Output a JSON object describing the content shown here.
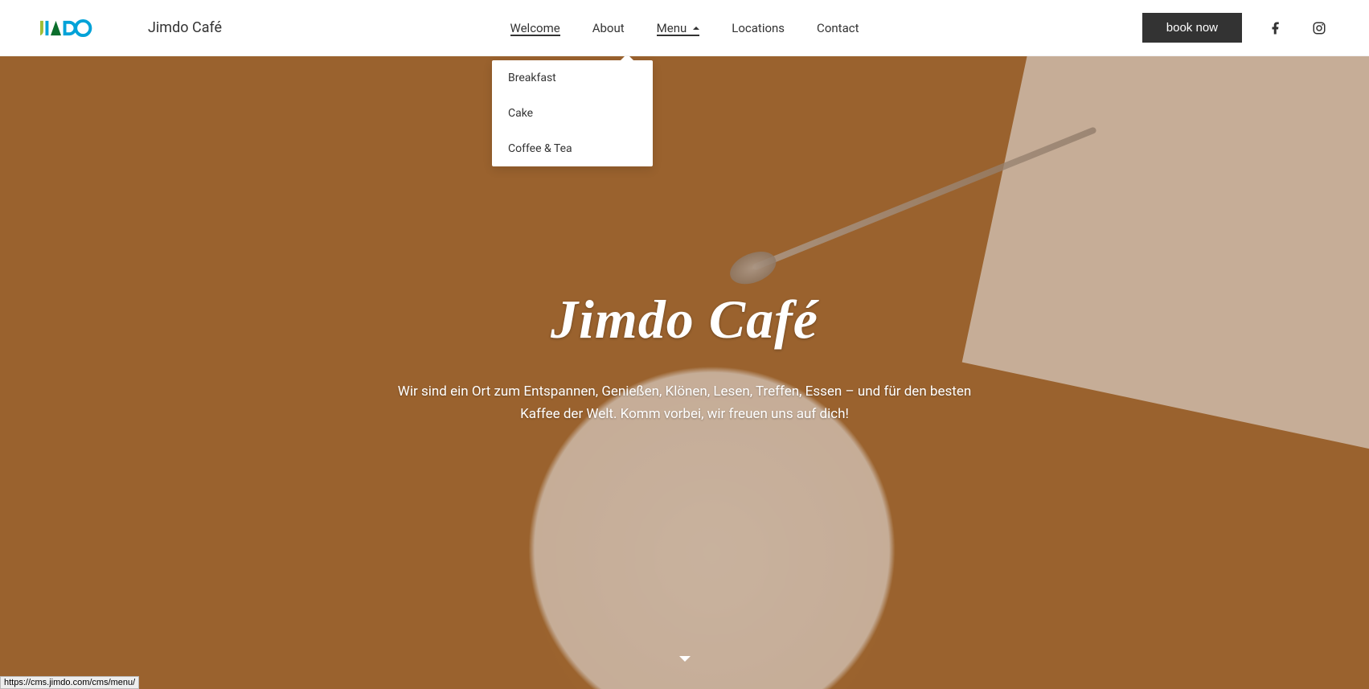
{
  "site": {
    "title": "Jimdo Café"
  },
  "nav": {
    "items": [
      {
        "label": "Welcome",
        "active": true
      },
      {
        "label": "About"
      },
      {
        "label": "Menu",
        "submenu": true
      },
      {
        "label": "Locations"
      },
      {
        "label": "Contact"
      }
    ]
  },
  "cta": {
    "label": "book now"
  },
  "dropdown": {
    "items": [
      {
        "label": "Breakfast"
      },
      {
        "label": "Cake"
      },
      {
        "label": "Coffee & Tea"
      }
    ]
  },
  "hero": {
    "title": "Jimdo Café",
    "subtitle": "Wir sind ein Ort zum Entspannen, Genießen, Klönen, Lesen, Treffen, Essen – und für den besten Kaffee der Welt. Komm vorbei, wir freuen uns auf dich!"
  },
  "status_url": "https://cms.jimdo.com/cms/menu/",
  "colors": {
    "brand_green": "#9fbd36",
    "brand_blue": "#00a2d8",
    "brand_dark": "#333333"
  }
}
